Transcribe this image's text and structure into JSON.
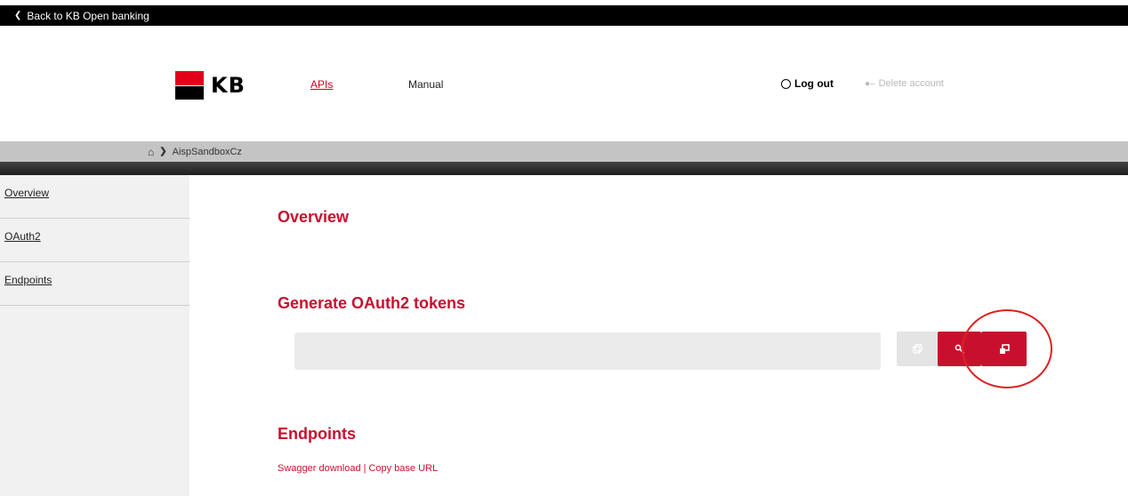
{
  "topbar": {
    "back_label": "Back to KB Open banking"
  },
  "header": {
    "logo_text": "KB",
    "nav": {
      "apis": "APIs",
      "manual": "Manual"
    },
    "logout": "Log out",
    "delete_account": "Delete account"
  },
  "breadcrumb": {
    "current": "AispSandboxCz"
  },
  "sidebar": {
    "items": [
      {
        "label": "Overview"
      },
      {
        "label": "OAuth2"
      },
      {
        "label": "Endpoints"
      }
    ]
  },
  "main": {
    "overview_title": "Overview",
    "generate_title": "Generate OAuth2 tokens",
    "token_value": "",
    "endpoints_title": "Endpoints",
    "swagger_link": "Swagger download",
    "copy_base_link": "Copy base URL"
  },
  "icons": [
    "chevron-left-icon",
    "user-icon",
    "user-remove-icon",
    "home-icon",
    "chevron-right-icon",
    "copy-icon",
    "key-icon",
    "open-window-icon"
  ],
  "colors": {
    "brand_red": "#c8102e",
    "logo_red": "#e2001a",
    "annotation": "#e02020"
  }
}
